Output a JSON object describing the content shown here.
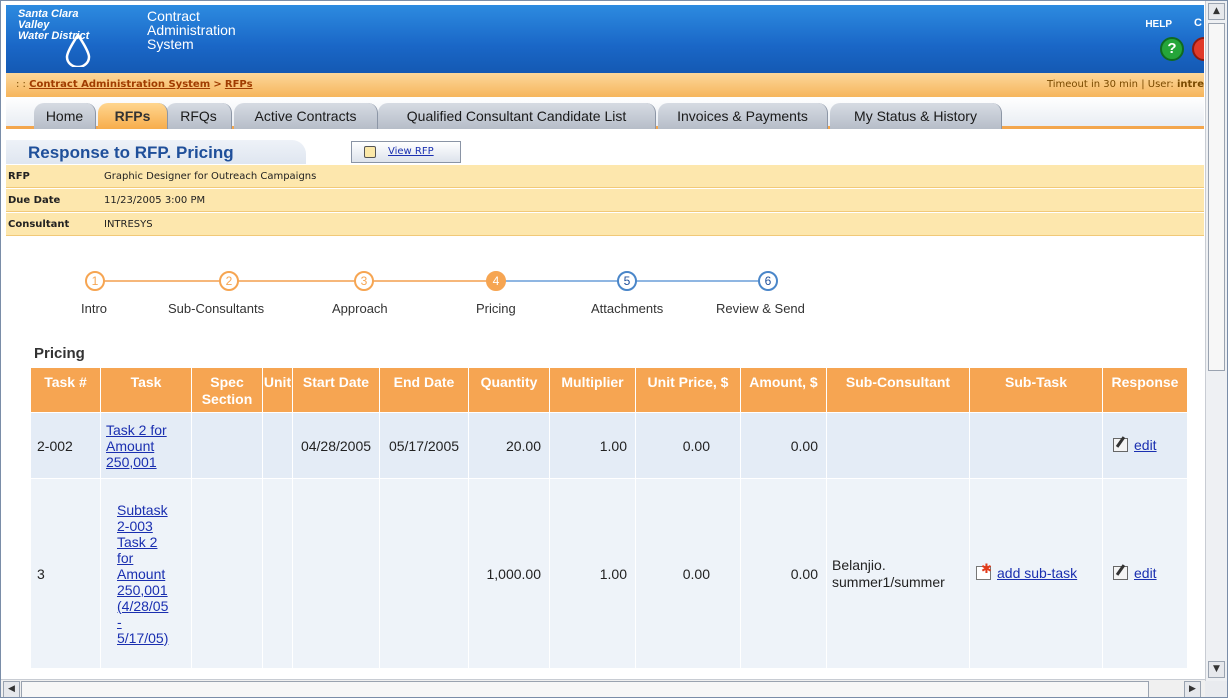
{
  "header": {
    "org_line1": "Santa Clara Valley",
    "org_line2": "Water District",
    "app_line1": "Contract",
    "app_line2": "Administration",
    "app_line3": "System",
    "help": "HELP",
    "help_glyph": "?",
    "trailing": "C"
  },
  "breadcrumb": {
    "prefix": ": :",
    "items": [
      "Contract Administration System",
      "RFPs"
    ],
    "separator": ">",
    "timeout": "Timeout in 30 min |",
    "user_label": "User:",
    "user_value": "intre"
  },
  "tabs": [
    {
      "label": "Home",
      "active": false
    },
    {
      "label": "RFPs",
      "active": true
    },
    {
      "label": "RFQs",
      "active": false
    },
    {
      "label": "Active Contracts",
      "active": false
    },
    {
      "label": "Qualified Consultant Candidate List",
      "active": false
    },
    {
      "label": "Invoices & Payments",
      "active": false
    },
    {
      "label": "My Status & History",
      "active": false
    }
  ],
  "page": {
    "title": "Response to RFP. Pricing",
    "view_rfp": "View RFP"
  },
  "info": {
    "rfp_label": "RFP",
    "rfp_value": "Graphic Designer for Outreach Campaigns",
    "due_label": "Due Date",
    "due_value": "11/23/2005 3:00 PM",
    "consultant_label": "Consultant",
    "consultant_value": "INTRESYS"
  },
  "steps": [
    {
      "num": "1",
      "label": "Intro",
      "state": "done"
    },
    {
      "num": "2",
      "label": "Sub-Consultants",
      "state": "done"
    },
    {
      "num": "3",
      "label": "Approach",
      "state": "done"
    },
    {
      "num": "4",
      "label": "Pricing",
      "state": "current"
    },
    {
      "num": "5",
      "label": "Attachments",
      "state": "todo"
    },
    {
      "num": "6",
      "label": "Review & Send",
      "state": "todo"
    }
  ],
  "colors": {
    "orange": "#f6a552",
    "blue": "#1a67c7",
    "step_done": "#f6a552",
    "step_todo": "#4a86c9"
  },
  "pricing": {
    "title": "Pricing",
    "columns": {
      "task_num": "Task #",
      "task": "Task",
      "spec_1": "Spec",
      "spec_2": "Section",
      "unit": "Unit",
      "start": "Start Date",
      "end": "End Date",
      "qty": "Quantity",
      "mult": "Multiplier",
      "unit_price": "Unit Price, $",
      "amount": "Amount, $",
      "sub_consultant": "Sub-Consultant",
      "sub_task": "Sub-Task",
      "response": "Response"
    },
    "rows": [
      {
        "task_num": "2-002",
        "task_l1": "Task 2 for",
        "task_l2": "Amount",
        "task_l3": "250,001",
        "spec": "",
        "unit": "",
        "start": "04/28/2005",
        "end": "05/17/2005",
        "qty": "20.00",
        "mult": "1.00",
        "unit_price": "0.00",
        "amount": "0.00",
        "sub_consultant": "",
        "sub_task": "",
        "response": "edit"
      },
      {
        "task_num": "3",
        "task_l1": "Subtask",
        "task_l2": "2-003",
        "task_l3": "Task 2",
        "task_l4": "for",
        "task_l5": "Amount",
        "task_l6": "250,001",
        "task_l7": "(4/28/05",
        "task_l8": "-",
        "task_l9": "5/17/05)",
        "spec": "",
        "unit": "",
        "start": "",
        "end": "",
        "qty": "1,000.00",
        "mult": "1.00",
        "unit_price": "0.00",
        "amount": "0.00",
        "sub_consultant_l1": "Belanjio.",
        "sub_consultant_l2": "summer1/summer",
        "sub_task": "add sub-task",
        "response": "edit"
      }
    ]
  },
  "scroll": {
    "up": "▲",
    "down": "▼",
    "left": "◀",
    "right": "▶"
  }
}
